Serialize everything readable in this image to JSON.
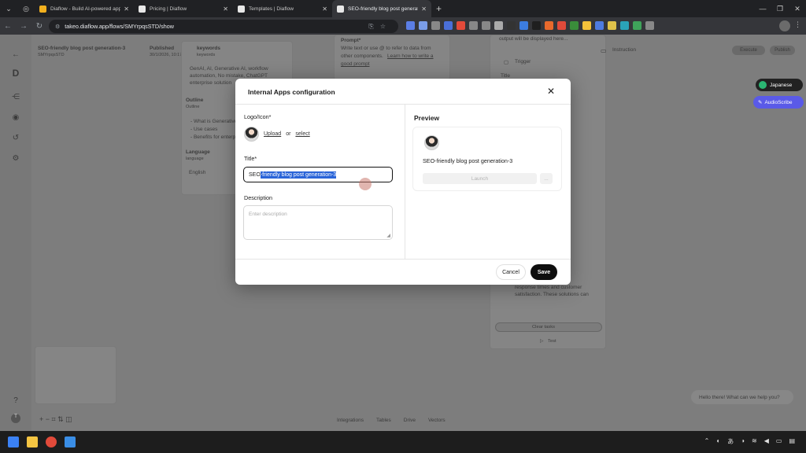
{
  "browser": {
    "tabs": [
      {
        "title": "Diaflow - Build AI-powered app",
        "active": false
      },
      {
        "title": "Pricing | Diaflow",
        "active": false
      },
      {
        "title": "Templates | Diaflow",
        "active": false
      },
      {
        "title": "SEO-friendly blog post generatio",
        "active": true
      }
    ],
    "url": "takeo.diaflow.app/flows/SMYrpqsSTD/show"
  },
  "background_app": {
    "flow_title": "SEO-friendly blog post generation-3",
    "flow_id": "SMYrpqsSTD",
    "published_label": "Published",
    "published_date": "30/1/2026, 10:17 pm",
    "keywords_label": "keywords",
    "keywords_sub": "keywords",
    "body_text_1": "GenAI, AI, Generative AI, workflow",
    "body_text_2": "automation, No mistake, ChatGPT",
    "body_text_3": "enterprise solution",
    "outline_label": "Outline",
    "outline_sub": "Outline",
    "outline_items": [
      "- What is Generative",
      "- Use cases",
      "- Benefits for enterp"
    ],
    "language_label": "Language",
    "language_sub": "language",
    "language_value": "English",
    "prompt_label": "Prompt*",
    "prompt_hint_1": "Write text or use @ to refer to data from",
    "prompt_hint_2": "other components.",
    "prompt_link": "Learn how to write a",
    "prompt_link_2": "good prompt",
    "output_text": "output will be displayed here...",
    "trigger_label": "Trigger",
    "title_label": "Title",
    "instruction_label": "Instruction",
    "execute_label": "Execute",
    "publish_label": "Publish",
    "response_text_1": "response times and customer",
    "response_text_2": "satisfaction. These solutions can",
    "clear_tasks_label": "Clear tasks",
    "test_label": "Test",
    "bottom_items": [
      "Integrations",
      "Tables",
      "Drive",
      "Vectors"
    ],
    "chat_greeting": "Hello there! What can we help you?",
    "language_badge": "Japanese",
    "scribe_badge": "AudioScribe"
  },
  "modal": {
    "title": "Internal Apps configuration",
    "logo_label": "Logo/Icon",
    "required_mark": "*",
    "upload_label": "Upload",
    "or_label": "or",
    "select_label": "select",
    "title_label": "Title",
    "title_value_plain": "SEO",
    "title_value_selected": "-friendly blog post generation-3",
    "description_label": "Description",
    "description_placeholder": "Enter description",
    "preview_label": "Preview",
    "preview_name": "SEO-friendly blog post generation-3",
    "launch_label": "Launch",
    "more_label": "...",
    "cancel_label": "Cancel",
    "save_label": "Save"
  }
}
